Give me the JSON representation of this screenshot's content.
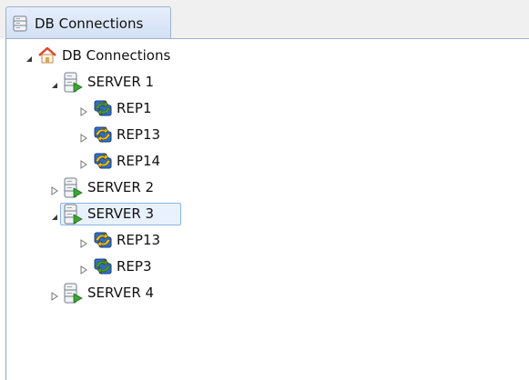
{
  "tab": {
    "title": "DB Connections",
    "icon": "database-icon"
  },
  "tree": {
    "root": {
      "label": "DB Connections",
      "icon": "home-icon",
      "expanded": true
    },
    "servers": [
      {
        "label": "SERVER 1",
        "icon": "server-icon",
        "expanded": true,
        "selected": false,
        "children": [
          {
            "label": "REP1",
            "icon": "replication-green-icon"
          },
          {
            "label": "REP13",
            "icon": "replication-yellow-icon"
          },
          {
            "label": "REP14",
            "icon": "replication-yellow-icon"
          }
        ]
      },
      {
        "label": "SERVER 2",
        "icon": "server-icon",
        "expanded": false,
        "selected": false,
        "children": []
      },
      {
        "label": "SERVER 3",
        "icon": "server-icon",
        "expanded": true,
        "selected": true,
        "children": [
          {
            "label": "REP13",
            "icon": "replication-yellow-icon"
          },
          {
            "label": "REP3",
            "icon": "replication-green-icon"
          }
        ]
      },
      {
        "label": "SERVER 4",
        "icon": "server-icon",
        "expanded": false,
        "selected": false,
        "children": []
      }
    ]
  },
  "colors": {
    "selection_border": "#8fb4e3",
    "selection_fill": "#e8f1fd",
    "tab_border": "#9fb2cc",
    "home_roof": "#e0452b",
    "server_arrow": "#3aa632",
    "rep_green": "#3aa632",
    "rep_yellow": "#f0c419",
    "rep_blue": "#2d6fd0"
  }
}
